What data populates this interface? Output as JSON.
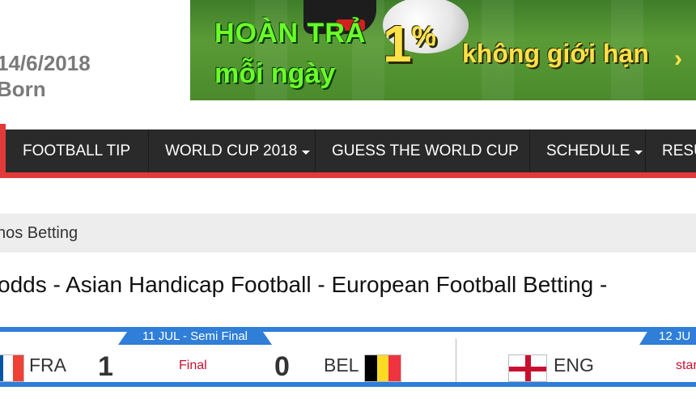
{
  "header": {
    "date_text": "14/6/2018",
    "author_text": "Born"
  },
  "banner": {
    "line1": "HOÀN TRẢ",
    "line2": "mỗi ngày",
    "percent": "1",
    "percent_sign": "%",
    "tagline": "không giới hạn",
    "colors": {
      "green_text": "#6bff2a",
      "yellow_text": "#ffe14a"
    }
  },
  "nav": {
    "items": [
      {
        "label": "FOOTBALL TIP",
        "has_dropdown": false
      },
      {
        "label": "WORLD CUP 2018",
        "has_dropdown": true
      },
      {
        "label": "GUESS THE WORLD CUP",
        "has_dropdown": false
      },
      {
        "label": "SCHEDULE",
        "has_dropdown": true
      },
      {
        "label": "RESU",
        "has_dropdown": false
      }
    ],
    "colors": {
      "background": "#2a2a2a",
      "accent": "#e23a3a"
    }
  },
  "breadcrumb": {
    "text": "nos Betting"
  },
  "page_title": "odds - Asian Handicap Football - European Football Betting -",
  "scoreboard": {
    "colors": {
      "bar": "#2f7ed8",
      "status": "#c8102e"
    },
    "matches": [
      {
        "tab_label": "11 JUL - Semi Final",
        "home_team": "FRA",
        "home_score": "1",
        "status": "Final",
        "away_score": "0",
        "away_team": "BEL"
      },
      {
        "tab_label": "12 JU",
        "home_team": "ENG",
        "status": "star"
      }
    ]
  }
}
